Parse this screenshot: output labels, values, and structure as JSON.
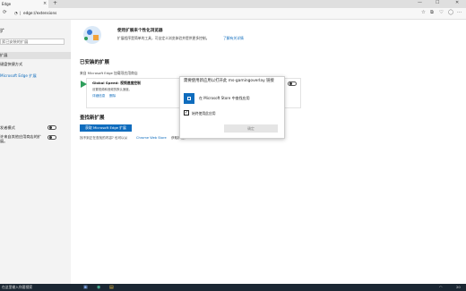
{
  "window": {
    "tab_title": "Edge",
    "close_glyph": "×",
    "new_tab_glyph": "+",
    "minimize_glyph": "—",
    "maximize_glyph": "☐",
    "close_window_glyph": "✕"
  },
  "address": {
    "url": "edge://extensions"
  },
  "sidebar": {
    "title": "扩",
    "search_placeholder": "索已安装的扩展",
    "items": [
      "扩展",
      "键盘快捷方式",
      "Microsoft Edge 扩展"
    ],
    "toggle_items": [
      "发者模式",
      "许来自其他应用商店的扩展。"
    ]
  },
  "banner": {
    "title": "使用扩展来个性化浏览器",
    "desc": "扩展程序是简单的工具，可自定义浏览体验并提供更多控制。",
    "link": "了解有关详情"
  },
  "installed": {
    "heading": "已安装的扩展",
    "source_label": "来自 Microsoft Edge 加载项应用商店",
    "extension_name": "Global Speed: 视频速度控制",
    "extension_desc": "设置视频和音频的默认速度。",
    "details_link": "详细信息",
    "remove_link": "删除"
  },
  "find": {
    "heading": "查找新扩展",
    "button": "获取 Microsoft Edge 扩展",
    "note": "找不到正在查找的内容? 也可以从",
    "note_link": "Chrome Web Store",
    "note_end": "获取扩展。"
  },
  "dialog": {
    "title": "需要使用新应用以打开此 ms-gamingoverlay 链接",
    "option": "在 Microsoft Store 中查找应用",
    "checkbox_label": "始终使用此应用",
    "checkbox_checked": true,
    "confirm": "确定"
  },
  "taskbar": {
    "search": "在这里输入你要搜索",
    "clock": "20"
  }
}
